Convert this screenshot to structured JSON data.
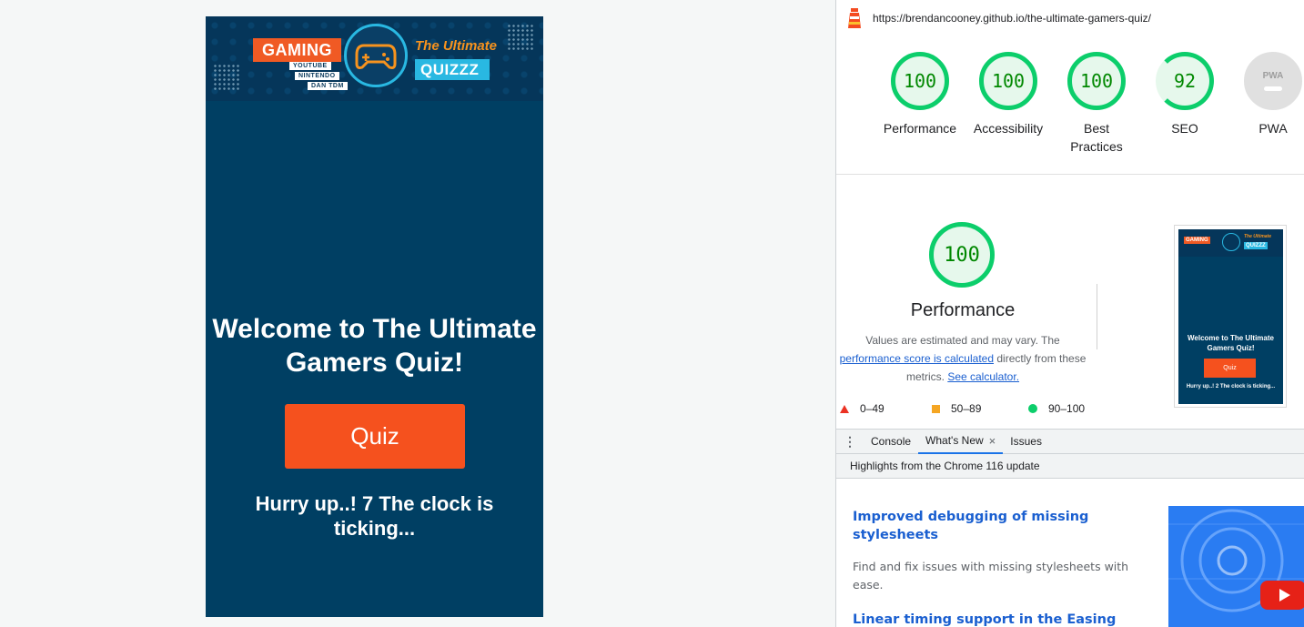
{
  "mobile": {
    "banner": {
      "gaming": "GAMING",
      "youtube": "YOUTUBE",
      "nintendo": "NINTENDO",
      "dantdm": "DAN TDM",
      "ultimate": "The Ultimate",
      "quizzz": "QUIZZZ",
      "icon": "gamepad-icon"
    },
    "welcome": "Welcome to The Ultimate Gamers Quiz!",
    "quiz_button": "Quiz",
    "hurry": "Hurry up..! 7 The clock is ticking..."
  },
  "devtools": {
    "url": "https://brendancooney.github.io/the-ultimate-gamers-quiz/",
    "lighthouse_icon": "lighthouse-icon",
    "gauges": [
      {
        "score": "100",
        "label": "Performance"
      },
      {
        "score": "100",
        "label": "Accessibility"
      },
      {
        "score": "100",
        "label": "Best Practices"
      },
      {
        "score": "92",
        "label": "SEO"
      },
      {
        "score": "PWA",
        "label": "PWA"
      }
    ],
    "performance": {
      "score": "100",
      "title": "Performance",
      "desc_1": "Values are estimated and may vary. The",
      "desc_link_1": "performance score is calculated",
      "desc_2": "directly from these metrics.",
      "desc_link_2": "See calculator.",
      "legend": [
        "0–49",
        "50–89",
        "90–100"
      ]
    },
    "thumbnail": {
      "gaming": "GAMING",
      "ultimate": "The Ultimate",
      "quizzz": "QUIZZZ",
      "welcome": "Welcome to The Ultimate Gamers Quiz!",
      "button": "Quiz",
      "hurry": "Hurry up..! 2 The clock is ticking..."
    },
    "drawer": {
      "tabs": [
        "Console",
        "What's New",
        "Issues"
      ],
      "close": "×",
      "highlights": "Highlights from the Chrome 116 update"
    },
    "whats_new": {
      "item1_title": "Improved debugging of missing stylesheets",
      "item1_body": "Find and fix issues with missing stylesheets with ease.",
      "item2_title": "Linear timing support in the Easing"
    },
    "colors": {
      "pass": "#0cce6b",
      "average": "#f5a623",
      "fail": "#eb3223",
      "link": "#1a5fd0"
    }
  }
}
